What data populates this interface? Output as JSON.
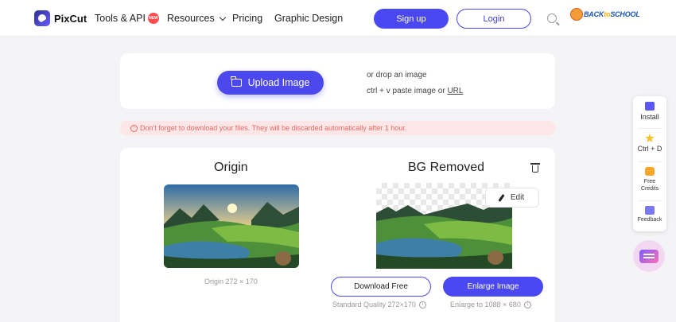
{
  "header": {
    "brand": "PixCut",
    "nav": {
      "tools": "Tools & API",
      "tools_badge": "NEW",
      "resources": "Resources",
      "pricing": "Pricing",
      "graphic_design": "Graphic Design"
    },
    "signup": "Sign up",
    "login": "Login",
    "promo": {
      "part1": "BACK",
      "part2": "to",
      "part3": "SCHOOL"
    }
  },
  "upload": {
    "button": "Upload Image",
    "drop_hint": "or drop an image",
    "paste_hint": "ctrl + v paste image or",
    "url_link": "URL"
  },
  "warning": "Don't forget to download your files. They will be discarded automatically after 1 hour.",
  "result": {
    "origin_title": "Origin",
    "removed_title": "BG Removed",
    "edit": "Edit",
    "origin_size": "Origin 272 × 170",
    "download_free": "Download Free",
    "enlarge": "Enlarge Image",
    "standard_note": "Standard Quality 272×170",
    "enlarge_note": "Enlarge to 1088 × 680"
  },
  "sidebar": {
    "install": "Install",
    "ctrl_d": "Ctrl + D",
    "free_credits_line1": "Free",
    "free_credits_line2": "Credits",
    "feedback": "Feedback"
  },
  "colors": {
    "accent": "#4a48f0",
    "warning_bg": "#fde6e6",
    "warning_text": "#e86868"
  }
}
